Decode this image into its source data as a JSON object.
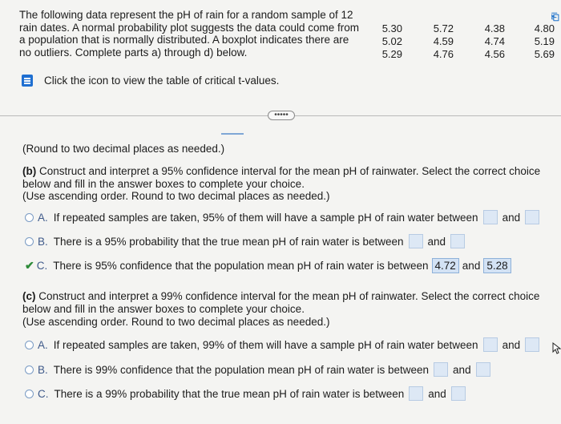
{
  "problem": {
    "text": "The following data represent the pH of rain for a random sample of 12 rain dates. A normal probability plot suggests the data could come from a population that is normally distributed. A boxplot indicates there are no outliers. Complete parts a) through d) below."
  },
  "data_table": {
    "columns": [
      [
        "5.30",
        "5.02",
        "5.29"
      ],
      [
        "5.72",
        "4.59",
        "4.76"
      ],
      [
        "4.38",
        "4.74",
        "4.56"
      ],
      [
        "4.80",
        "5.19",
        "5.69"
      ]
    ]
  },
  "table_link": {
    "text": "Click the icon to view the table of critical t-values."
  },
  "more_button": {
    "label": "•••••"
  },
  "part_a_note": "(Round to two decimal places as needed.)",
  "part_b": {
    "label": "(b)",
    "prompt": "Construct and interpret a 95% confidence interval for the mean pH of rainwater. Select the correct choice below and fill in the answer boxes to complete your choice.",
    "instruction": "(Use ascending order. Round to two decimal places as needed.)",
    "choices": [
      {
        "letter": "A.",
        "text": "If repeated samples are taken, 95% of them will have a sample pH of rain water between",
        "and": "and"
      },
      {
        "letter": "B.",
        "text": "There is a 95% probability that the true mean pH of rain water is between",
        "and": "and"
      },
      {
        "letter": "C.",
        "text": "There is 95% confidence that the population mean pH of rain water is between",
        "and": "and",
        "low": "4.72",
        "high": "5.28"
      }
    ]
  },
  "part_c": {
    "label": "(c)",
    "prompt": "Construct and interpret a 99% confidence interval for the mean pH of rainwater. Select the correct choice below and fill in the answer boxes to complete your choice.",
    "instruction": "(Use ascending order. Round to two decimal places as needed.)",
    "choices": [
      {
        "letter": "A.",
        "text": "If repeated samples are taken, 99% of them will have a sample pH of rain water between",
        "and": "and"
      },
      {
        "letter": "B.",
        "text": "There is 99% confidence that the population mean pH of rain water is between",
        "and": "and"
      },
      {
        "letter": "C.",
        "text": "There is a 99% probability that the true mean pH of rain water is between",
        "and": "and"
      }
    ]
  }
}
